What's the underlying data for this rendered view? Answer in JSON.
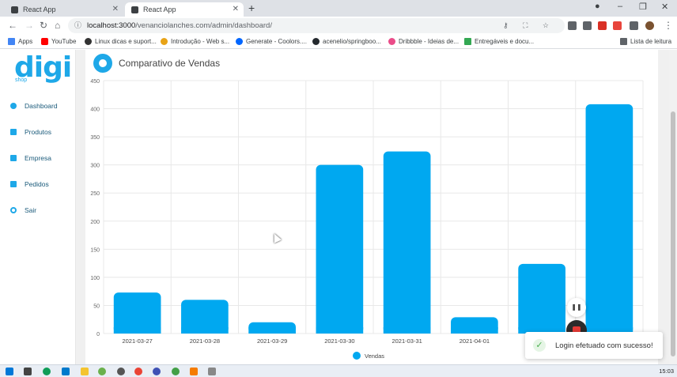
{
  "browser": {
    "tabs": [
      {
        "title": "React App",
        "active": false
      },
      {
        "title": "React App",
        "active": true
      }
    ],
    "url_host": "localhost:3000",
    "url_path": "/venanciolanches.com/admin/dashboard/",
    "bookmarks": [
      {
        "label": "Apps",
        "color": "#4285f4"
      },
      {
        "label": "YouTube",
        "color": "#ff0000"
      },
      {
        "label": "Linux dicas e suport...",
        "color": "#333333"
      },
      {
        "label": "Introdução - Web s...",
        "color": "#e8a317"
      },
      {
        "label": "Generate - Coolors....",
        "color": "#0066ff"
      },
      {
        "label": "acenelio/springboo...",
        "color": "#24292e"
      },
      {
        "label": "Dribbble - Ideias de...",
        "color": "#ea4c89"
      },
      {
        "label": "Entregáveis e docu...",
        "color": "#34a853"
      }
    ],
    "reading_list": "Lista de leitura"
  },
  "sidebar": {
    "logo": "digi",
    "logo_sub": "shop",
    "items": [
      {
        "label": "Dashboard"
      },
      {
        "label": "Produtos"
      },
      {
        "label": "Empresa"
      },
      {
        "label": "Pedidos"
      },
      {
        "label": "Sair"
      }
    ]
  },
  "card": {
    "title": "Comparativo de Vendas"
  },
  "chart_data": {
    "type": "bar",
    "title": "",
    "xlabel": "",
    "ylabel": "",
    "categories": [
      "2021-03-27",
      "2021-03-28",
      "2021-03-29",
      "2021-03-30",
      "2021-03-31",
      "2021-04-01",
      "",
      ""
    ],
    "series": [
      {
        "name": "Vendas",
        "values": [
          73,
          60,
          20,
          300,
          324,
          29,
          124,
          408
        ]
      }
    ],
    "ylim": [
      0,
      450
    ],
    "yticks": [
      0,
      50,
      100,
      150,
      200,
      250,
      300,
      350,
      400,
      450
    ],
    "grid": true,
    "legend": "bottom",
    "color": "#00a8f0"
  },
  "toast": {
    "message": "Login efetuado com sucesso!"
  },
  "taskbar": {
    "time": "15:03"
  },
  "colors": {
    "accent": "#1ea8e8",
    "bar": "#00a8f0"
  }
}
